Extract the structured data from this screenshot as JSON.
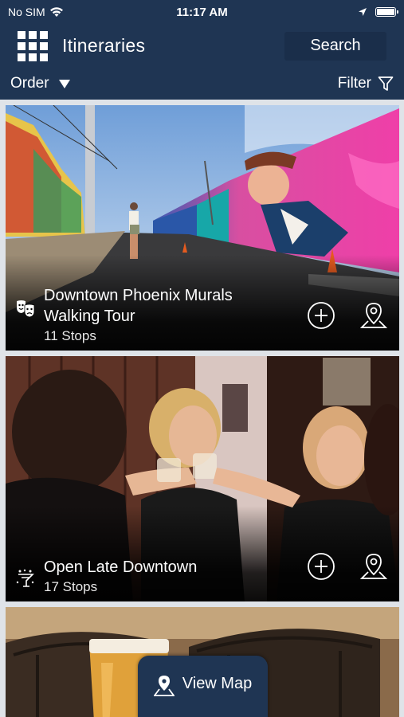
{
  "status_bar": {
    "carrier": "No SIM",
    "time": "11:17 AM"
  },
  "header": {
    "title": "Itineraries",
    "search_label": "Search",
    "menu_icon": "grid-menu-icon"
  },
  "toolbar": {
    "order_label": "Order",
    "filter_label": "Filter"
  },
  "itineraries": [
    {
      "title": "Downtown Phoenix Murals Walking Tour",
      "stops": "11 Stops",
      "category_icon": "theater-masks-icon"
    },
    {
      "title": "Open Late Downtown",
      "stops": "17 Stops",
      "category_icon": "nightlife-icon"
    },
    {
      "title": "",
      "stops": "",
      "category_icon": "dining-icon"
    }
  ],
  "view_map": {
    "label": "View Map"
  },
  "colors": {
    "navy": "#1f3553",
    "navy_dark": "#1a2e4a",
    "list_background": "#dfe3e8",
    "white": "#ffffff"
  }
}
